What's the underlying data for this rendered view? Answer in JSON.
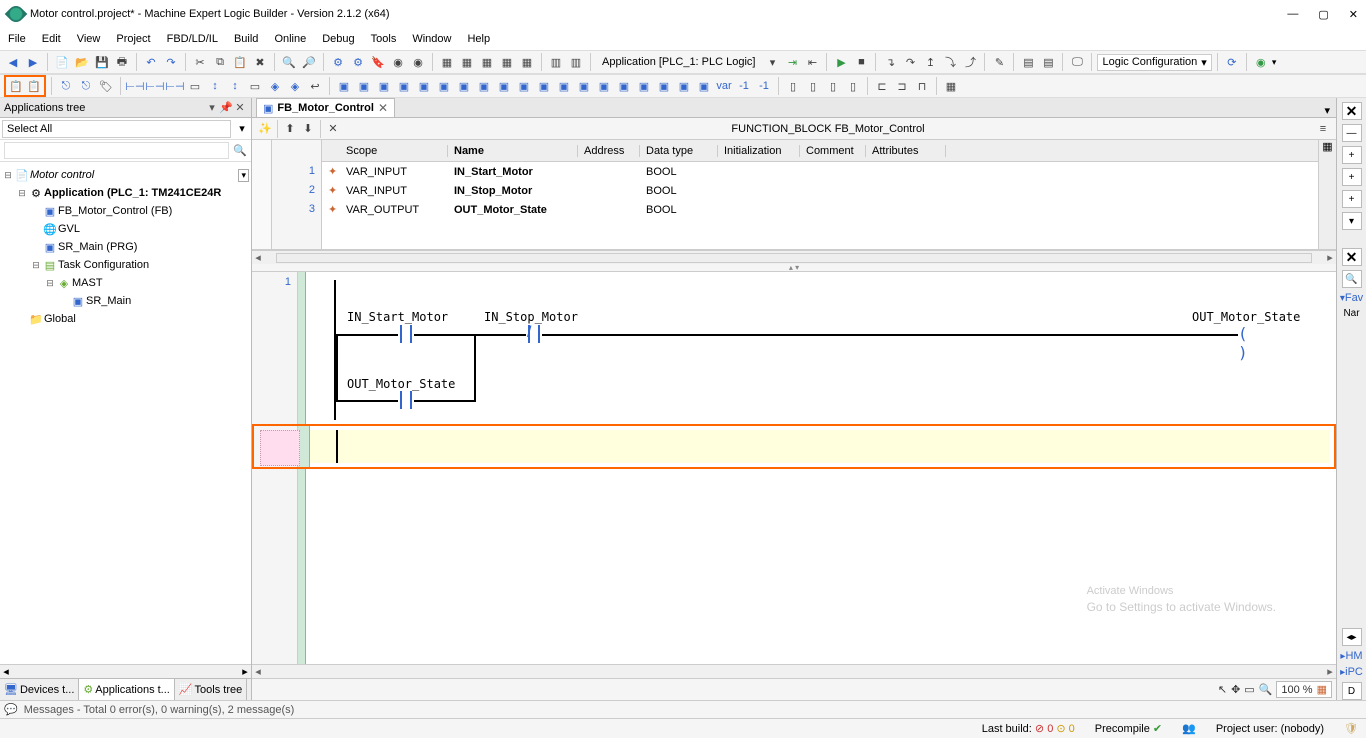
{
  "window": {
    "title": "Motor control.project* - Machine Expert Logic Builder - Version 2.1.2 (x64)"
  },
  "menu": [
    "File",
    "Edit",
    "View",
    "Project",
    "FBD/LD/IL",
    "Build",
    "Online",
    "Debug",
    "Tools",
    "Window",
    "Help"
  ],
  "toolbar": {
    "app_context": "Application [PLC_1: PLC Logic]",
    "logic_config": "Logic Configuration"
  },
  "apps_panel": {
    "title": "Applications tree",
    "filter": "Select All",
    "tree": {
      "root": "Motor control",
      "app": "Application (PLC_1: TM241CE24R",
      "fb": "FB_Motor_Control (FB)",
      "gvl": "GVL",
      "sr_main_prg": "SR_Main (PRG)",
      "task_cfg": "Task Configuration",
      "mast": "MAST",
      "sr_main": "SR_Main",
      "global": "Global"
    },
    "tabs": {
      "devices": "Devices t...",
      "apps": "Applications t...",
      "tools": "Tools tree"
    }
  },
  "editor": {
    "tab_label": "FB_Motor_Control",
    "header": "FUNCTION_BLOCK FB_Motor_Control",
    "columns": [
      "Scope",
      "Name",
      "Address",
      "Data type",
      "Initialization",
      "Comment",
      "Attributes"
    ],
    "rows": [
      {
        "n": "1",
        "scope": "VAR_INPUT",
        "name": "IN_Start_Motor",
        "type": "BOOL"
      },
      {
        "n": "2",
        "scope": "VAR_INPUT",
        "name": "IN_Stop_Motor",
        "type": "BOOL"
      },
      {
        "n": "3",
        "scope": "VAR_OUTPUT",
        "name": "OUT_Motor_State",
        "type": "BOOL"
      }
    ]
  },
  "ladder": {
    "rung_no": "1",
    "start": "IN_Start_Motor",
    "stop": "IN_Stop_Motor",
    "state": "OUT_Motor_State",
    "latch": "OUT_Motor_State"
  },
  "zoom": {
    "value": "100 %"
  },
  "watermark": {
    "big": "Activate Windows",
    "small": "Go to Settings to activate Windows."
  },
  "right": {
    "fav": "Fav",
    "nar": "Nar",
    "hm": "HM",
    "ipc": "iPC",
    "d": "D"
  },
  "messages": "Messages - Total 0 error(s), 0 warning(s), 2 message(s)",
  "status": {
    "last_build": "Last build:",
    "err": "0",
    "warn": "0",
    "precompile": "Precompile",
    "user": "Project user: (nobody)"
  }
}
